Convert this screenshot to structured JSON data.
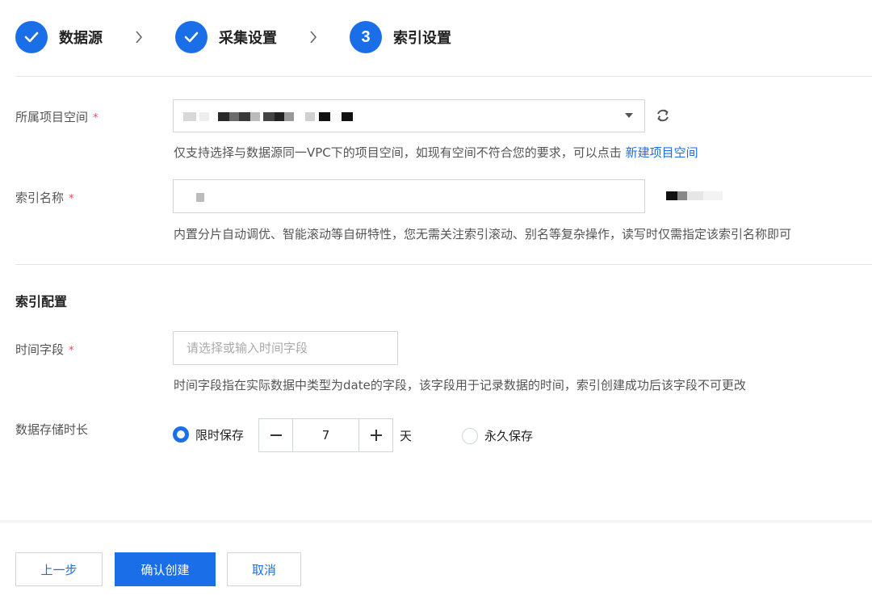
{
  "steps": [
    {
      "label": "数据源",
      "state": "done"
    },
    {
      "label": "采集设置",
      "state": "done"
    },
    {
      "label": "索引设置",
      "state": "current",
      "number": "3"
    }
  ],
  "form": {
    "project_space": {
      "label": "所属项目空间",
      "required_mark": "*",
      "hint": "仅支持选择与数据源同一VPC下的项目空间，如现有空间不符合您的要求，可以点击",
      "hint_link": "新建项目空间"
    },
    "index_name": {
      "label": "索引名称",
      "required_mark": "*",
      "hint": "内置分片自动调优、智能滚动等自研特性，您无需关注索引滚动、别名等复杂操作，读写时仅需指定该索引名称即可"
    },
    "index_config_title": "索引配置",
    "time_field": {
      "label": "时间字段",
      "required_mark": "*",
      "placeholder": "请选择或输入时间字段",
      "hint": "时间字段指在实际数据中类型为date的字段，该字段用于记录数据的时间，索引创建成功后该字段不可更改"
    },
    "retention": {
      "label": "数据存储时长",
      "option_limited": "限时保存",
      "value": "7",
      "unit": "天",
      "option_forever": "永久保存",
      "selected": "limited"
    }
  },
  "footer": {
    "prev_label": "上一步",
    "confirm_label": "确认创建",
    "cancel_label": "取消"
  },
  "colors": {
    "primary": "#1a6fe8",
    "required": "#e34d59"
  }
}
